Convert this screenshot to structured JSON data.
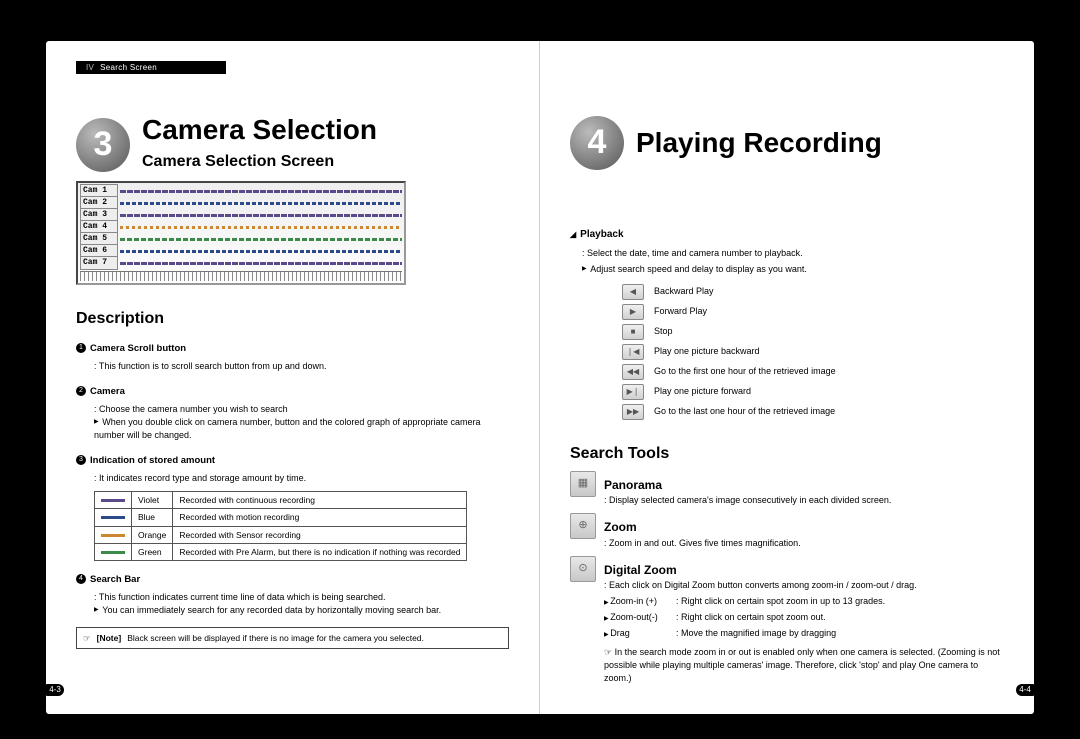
{
  "header": {
    "roman": "IV",
    "title": "Search Screen"
  },
  "left": {
    "badge": "3",
    "title": "Camera Selection",
    "subtitle": "Camera Selection Screen",
    "cams": [
      "Cam 1",
      "Cam 2",
      "Cam 3",
      "Cam 4",
      "Cam 5",
      "Cam 6",
      "Cam 7"
    ],
    "desc_title": "Description",
    "d1_head": "Camera Scroll button",
    "d1_text": "This function is to scroll search button from up and down.",
    "d2_head": "Camera",
    "d2_text": "Choose the camera number you wish to search",
    "d2_arrow": "When you double click on camera number, button and the colored graph of appropriate camera number will be changed.",
    "d3_head": "Indication of stored amount",
    "d3_text": "It indicates record type and storage amount by time.",
    "color_rows": [
      {
        "c": "Violet",
        "t": "Recorded with continuous recording"
      },
      {
        "c": "Blue",
        "t": "Recorded with motion recording"
      },
      {
        "c": "Orange",
        "t": "Recorded with Sensor recording"
      },
      {
        "c": "Green",
        "t": "Recorded with Pre Alarm, but there is no indication if nothing was recorded"
      }
    ],
    "d4_head": "Search Bar",
    "d4_text": "This function indicates current time line of data which is being searched.",
    "d4_arrow": "You can immediately search for any recorded data by horizontally moving search bar.",
    "note_tag": "[Note]",
    "note_text": "Black screen will be displayed if there is no image for the camera you selected.",
    "page_num": "4-3"
  },
  "right": {
    "badge": "4",
    "title": "Playing Recording",
    "pb_head": "Playback",
    "pb_text": "Select the date, time and camera number to playback.",
    "pb_arrow": "Adjust search speed and delay to display as you want.",
    "controls": [
      {
        "g": "◀",
        "t": "Backward Play"
      },
      {
        "g": "▶",
        "t": "Forward Play"
      },
      {
        "g": "■",
        "t": "Stop"
      },
      {
        "g": "❘◀",
        "t": "Play one picture backward"
      },
      {
        "g": "◀◀",
        "t": "Go to the first one hour of the retrieved image"
      },
      {
        "g": "▶❘",
        "t": "Play one picture forward"
      },
      {
        "g": "▶▶",
        "t": "Go to the last one hour of the retrieved image"
      }
    ],
    "tools_title": "Search Tools",
    "panorama_h": "Panorama",
    "panorama_t": "Display selected camera's image consecutively in each divided screen.",
    "zoom_h": "Zoom",
    "zoom_t": "Zoom in and out. Gives five times magnification.",
    "dz_h": "Digital Zoom",
    "dz_t": "Each click on Digital Zoom button converts among zoom-in / zoom-out / drag.",
    "dz_lines": [
      {
        "k": "Zoom-in (+)",
        "v": "Right click on certain spot zoom in up to 13 grades."
      },
      {
        "k": "Zoom-out(-)",
        "v": "Right click on certain spot zoom out."
      },
      {
        "k": "Drag",
        "v": "Move the magnified image by dragging"
      }
    ],
    "dz_note": "In the search mode zoom in or out is enabled only when one camera is selected. (Zooming is not possible while playing multiple cameras' image. Therefore, click 'stop' and play One camera to zoom.)",
    "page_num": "4-4"
  }
}
